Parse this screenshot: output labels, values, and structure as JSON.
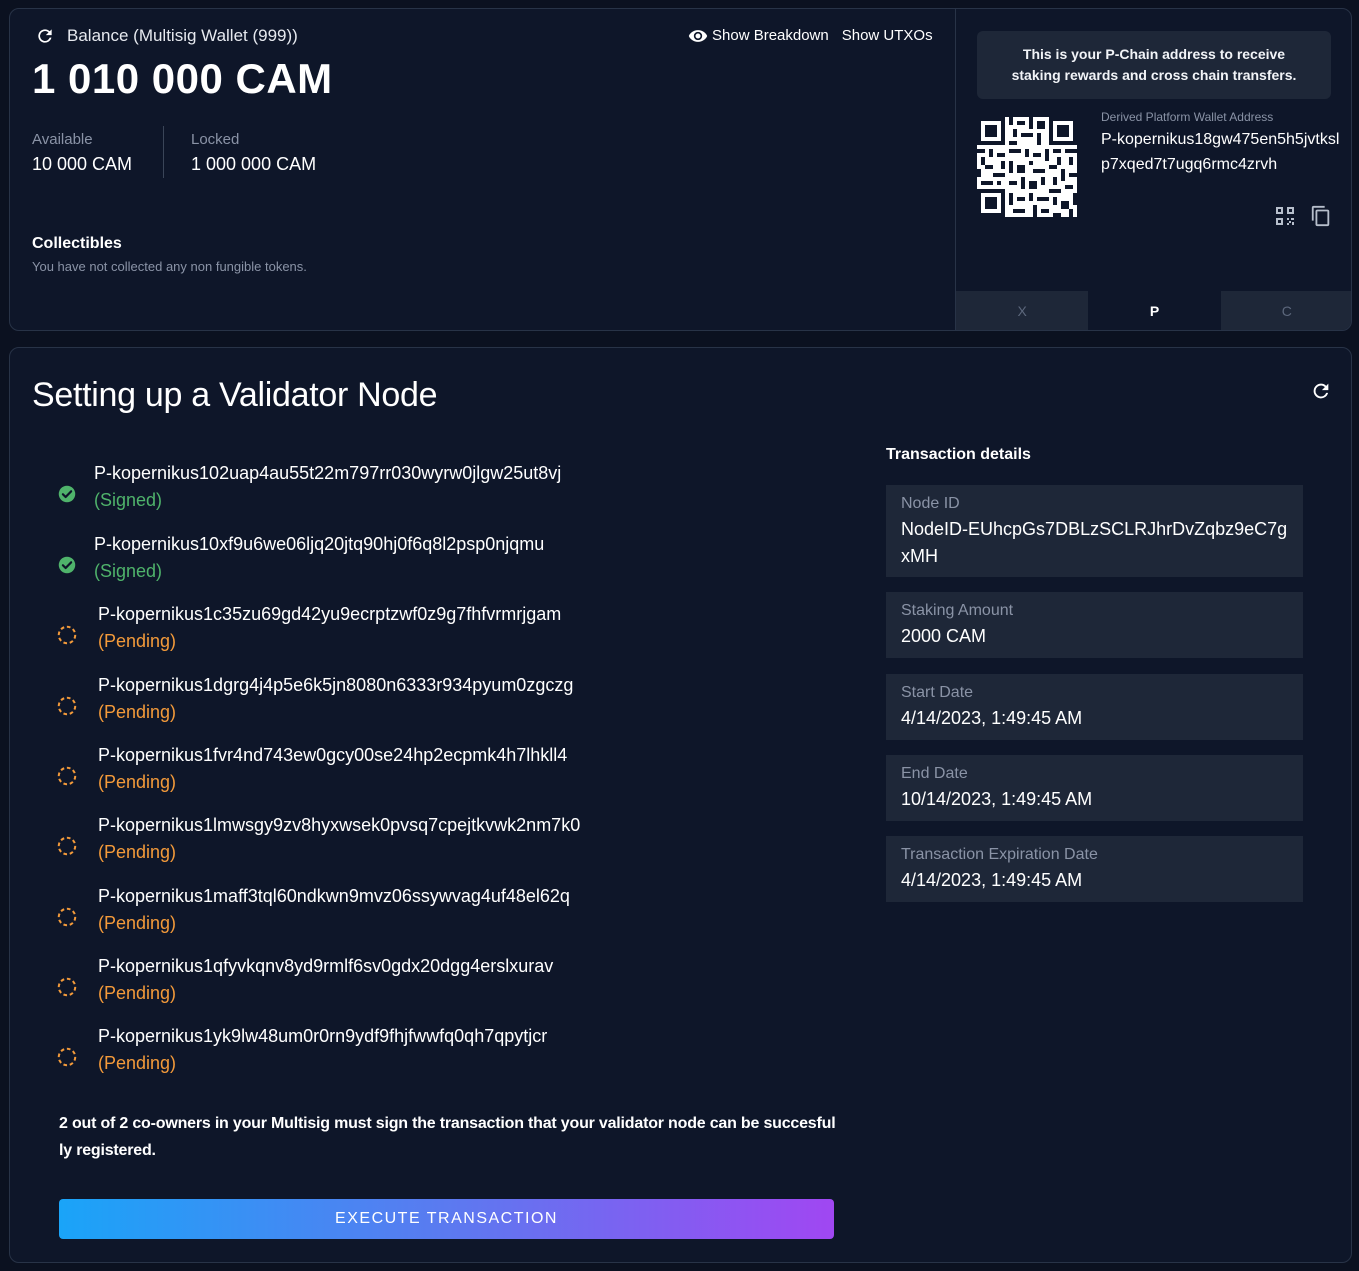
{
  "balance": {
    "title": "Balance (Multisig Wallet (999))",
    "amount": "1 010 000 CAM",
    "show_breakdown": "Show Breakdown",
    "show_utxos": "Show UTXOs",
    "available_label": "Available",
    "available_value": "10 000 CAM",
    "locked_label": "Locked",
    "locked_value": "1 000 000 CAM"
  },
  "collectibles": {
    "title": "Collectibles",
    "empty_text": "You have not collected any non fungible tokens."
  },
  "address_panel": {
    "info": "This is your P-Chain address to receive staking rewards and cross chain transfers.",
    "label": "Derived Platform Wallet Address",
    "address": "P-kopernikus18gw475en5h5jvtkslp7xqed7t7ugq6rmc4zrvh",
    "chain_tabs": [
      "X",
      "P",
      "C"
    ],
    "active_chain": "P"
  },
  "validator": {
    "title": "Setting up a Validator Node",
    "signers": [
      {
        "address": "P-kopernikus102uap4au55t22m797rr030wyrw0jlgw25ut8vj",
        "status": "(Signed)",
        "state": "signed"
      },
      {
        "address": "P-kopernikus10xf9u6we06ljq20jtq90hj0f6q8l2psp0njqmu",
        "status": "(Signed)",
        "state": "signed"
      },
      {
        "address": "P-kopernikus1c35zu69gd42yu9ecrptzwf0z9g7fhfvrmrjgam",
        "status": "(Pending)",
        "state": "pending"
      },
      {
        "address": "P-kopernikus1dgrg4j4p5e6k5jn8080n6333r934pyum0zgczg",
        "status": "(Pending)",
        "state": "pending"
      },
      {
        "address": "P-kopernikus1fvr4nd743ew0gcy00se24hp2ecpmk4h7lhkll4",
        "status": "(Pending)",
        "state": "pending"
      },
      {
        "address": "P-kopernikus1lmwsgy9zv8hyxwsek0pvsq7cpejtkvwk2nm7k0",
        "status": "(Pending)",
        "state": "pending"
      },
      {
        "address": "P-kopernikus1maff3tql60ndkwn9mvz06ssywvag4uf48el62q",
        "status": "(Pending)",
        "state": "pending"
      },
      {
        "address": "P-kopernikus1qfyvkqnv8yd9rmlf6sv0gdx20dgg4erslxurav",
        "status": "(Pending)",
        "state": "pending"
      },
      {
        "address": "P-kopernikus1yk9lw48um0r0rn9ydf9fhjfwwfq0qh7qpytjcr",
        "status": "(Pending)",
        "state": "pending"
      }
    ],
    "notice": "2 out of 2 co-owners in your Multisig must sign the transaction that your validator node can be succesfully registered.",
    "execute_label": "EXECUTE TRANSACTION"
  },
  "details": {
    "title": "Transaction details",
    "items": [
      {
        "label": "Node ID",
        "value": "NodeID-EUhcpGs7DBLzSCLRJhrDvZqbz9eC7gxMH"
      },
      {
        "label": "Staking Amount",
        "value": "2000 CAM"
      },
      {
        "label": "Start Date",
        "value": "4/14/2023, 1:49:45 AM"
      },
      {
        "label": "End Date",
        "value": "10/14/2023, 1:49:45 AM"
      },
      {
        "label": "Transaction Expiration Date",
        "value": "4/14/2023, 1:49:45 AM"
      }
    ]
  },
  "colors": {
    "signed": "#4fb36b",
    "pending": "#f39a3a",
    "background": "#0b1120",
    "card": "#0e1629"
  },
  "icons": [
    "refresh-icon",
    "eye-icon",
    "qr-code-icon",
    "copy-icon",
    "check-circle-icon",
    "pending-circle-icon"
  ]
}
